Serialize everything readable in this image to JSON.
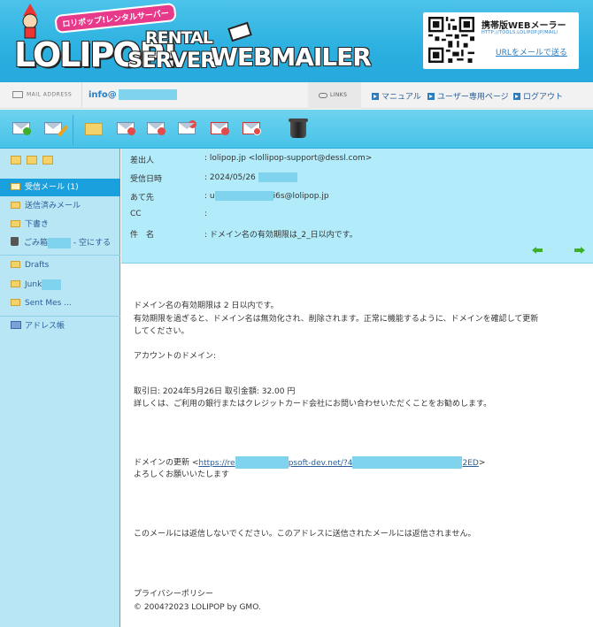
{
  "header": {
    "logo_badge": "ロリポップ!レンタルサーバー",
    "logo_main": "LOLIPOP!",
    "logo_rental": "RENTAL",
    "logo_server": "SERVER",
    "logo_webmailer": "WEBMAILER",
    "qr_title": "携帯版WEBメーラー",
    "qr_url": "HTTP://TOOLS.LOLIPOP.JP/MAIL/",
    "qr_link": "URLをメールで送る"
  },
  "addressbar": {
    "label": "MAIL ADDRESS",
    "email": "info@",
    "links_label": "LINKS",
    "links": [
      "マニュアル",
      "ユーザー専用ページ",
      "ログアウト"
    ]
  },
  "sidebar": {
    "folders": [
      {
        "label": "受信メール (1)",
        "active": true
      },
      {
        "label": "送信済みメール"
      },
      {
        "label": "下書き"
      },
      {
        "label_prefix": "ごみ箱",
        "label_suffix": "- 空にする"
      }
    ],
    "extra_folders": [
      "Drafts",
      "Junk",
      "Sent Mes ..."
    ],
    "address_book": "アドレス帳"
  },
  "message": {
    "from_label": "差出人",
    "from_value": ": lolipop.jp <lollipop-support@dessl.com>",
    "date_label": "受信日時",
    "date_value": ": 2024/05/26",
    "to_label": "あて先",
    "to_prefix": ": u",
    "to_suffix": "i6s@lolipop.jp",
    "cc_label": "CC",
    "cc_value": ":",
    "subject_label": "件　名",
    "subject_value": ": ドメイン名の有効期限は_2_日以内です。"
  },
  "body": {
    "line1": "ドメイン名の有効期限は 2 日以内です。",
    "line2": "有効期限を過ぎると、ドメイン名は無効化され、削除されます。正常に機能するように、ドメインを確認して更新",
    "line3": "してください。",
    "line4": "アカウントのドメイン:",
    "line5": "取引日: 2024年5月26日 取引金額: 32.00 円",
    "line6": "詳しくは、ご利用の銀行またはクレジットカード会社にお問い合わせいただくことをお勧めします。",
    "renew_prefix": "ドメインの更新 <",
    "renew_link_a": "https://re",
    "renew_link_b": "psoft-dev.net/?4",
    "renew_link_c": "2ED",
    "renew_suffix": ">",
    "line8": "よろしくお願いいたします",
    "line9": "このメールには返信しないでください。このアドレスに送信されたメールには返信されません。",
    "line10": "プライバシーポリシー",
    "line11": "© 2004?2023 LOLIPOP by GMO."
  },
  "colors": {
    "header_blue": "#2bb0e0",
    "toolbar_blue": "#46c2e8",
    "sidebar_bg": "#b8e6f5",
    "active_folder": "#1aa0dc",
    "message_header_bg": "#b2ecfa",
    "redaction": "#7fd3ec"
  }
}
